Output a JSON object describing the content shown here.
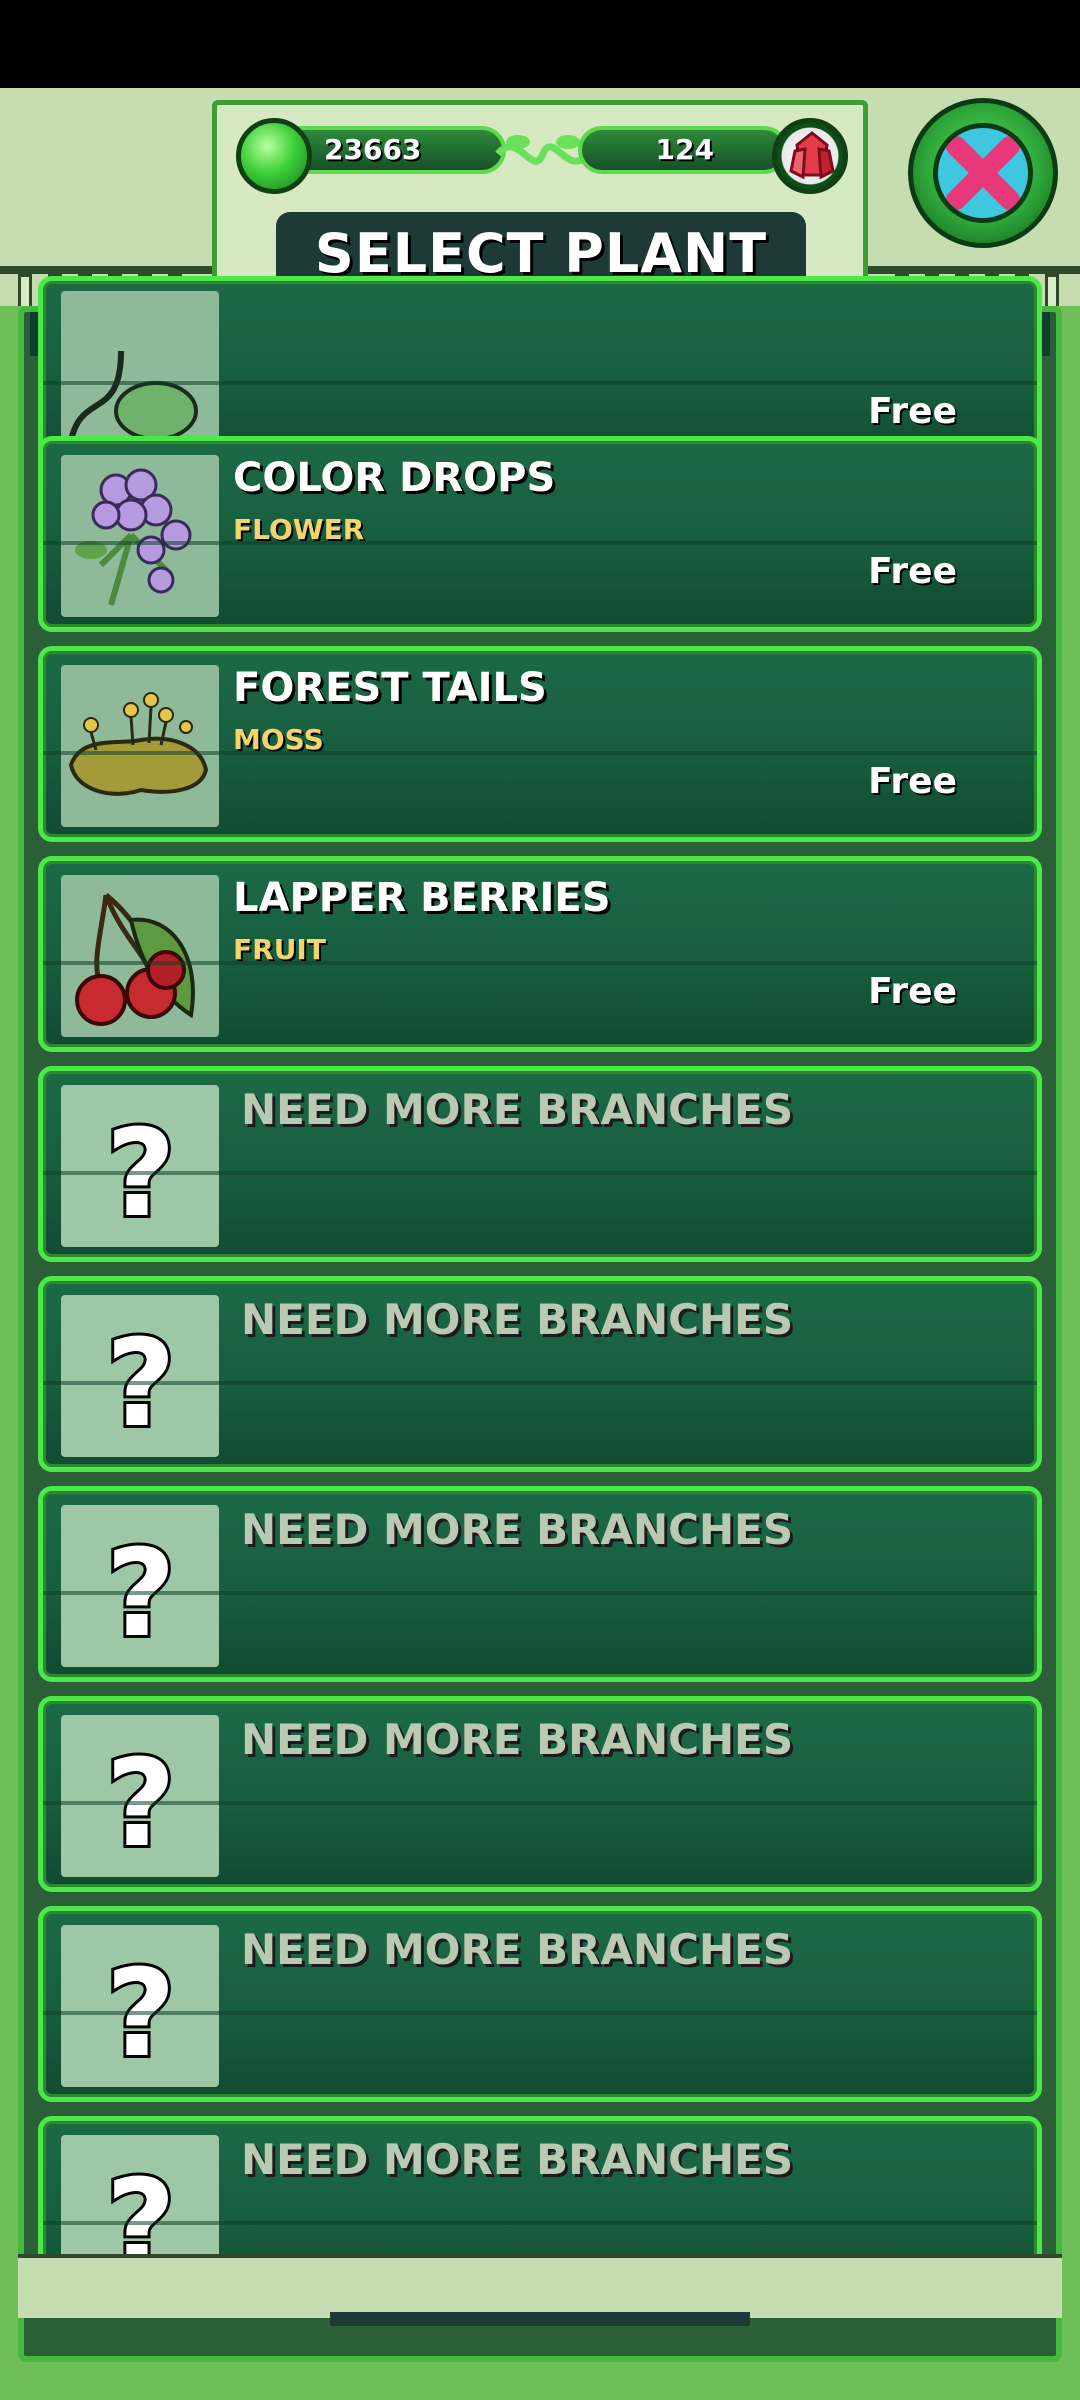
{
  "header": {
    "title": "SELECT PLANT",
    "gems": "23663",
    "crystals": "124",
    "close_icon": "close-x-icon"
  },
  "plants": [
    {
      "name": "",
      "type": "",
      "price": "Free",
      "icon": "vine-leaf-icon"
    },
    {
      "name": "COLOR DROPS",
      "type": "FLOWER",
      "price": "Free",
      "icon": "flower-icon"
    },
    {
      "name": "FOREST TAILS",
      "type": "MOSS",
      "price": "Free",
      "icon": "moss-icon"
    },
    {
      "name": "LAPPER BERRIES",
      "type": "FRUIT",
      "price": "Free",
      "icon": "cherry-icon"
    }
  ],
  "locked": [
    {
      "label": "NEED MORE BRANCHES"
    },
    {
      "label": "NEED MORE BRANCHES"
    },
    {
      "label": "NEED MORE BRANCHES"
    },
    {
      "label": "NEED MORE BRANCHES"
    },
    {
      "label": "NEED MORE BRANCHES"
    },
    {
      "label": "NEED MORE BRANCHES"
    }
  ],
  "colors": {
    "accent": "#4ce84a",
    "card": "#1c6a47",
    "type_text": "#f2d56b",
    "close_pink": "#e8387a",
    "close_blue": "#3fc6e0"
  }
}
